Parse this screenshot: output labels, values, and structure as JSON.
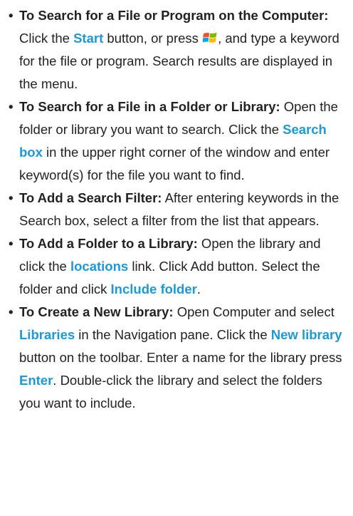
{
  "tips": [
    {
      "parts": [
        {
          "t": "bold",
          "v": "To Search for a File or Program on the Computer:"
        },
        {
          "t": "text",
          "v": " Click the "
        },
        {
          "t": "hl",
          "v": "Start"
        },
        {
          "t": "text",
          "v": " button, or press "
        },
        {
          "t": "icon",
          "v": "windows-logo-icon"
        },
        {
          "t": "text",
          "v": ", and type a keyword for the file or program. Search results are displayed in the menu."
        }
      ]
    },
    {
      "parts": [
        {
          "t": "bold",
          "v": "To Search for a File in a Folder or Library:"
        },
        {
          "t": "text",
          "v": " Open the folder or library you want to search. Click the "
        },
        {
          "t": "hl",
          "v": "Search box"
        },
        {
          "t": "text",
          "v": " in the upper right corner of the window and enter keyword(s) for the file you want to find."
        }
      ]
    },
    {
      "parts": [
        {
          "t": "bold",
          "v": "To Add a Search Filter:"
        },
        {
          "t": "text",
          "v": " After entering keywords in the Search box, select a filter from the list that appears."
        }
      ]
    },
    {
      "parts": [
        {
          "t": "bold",
          "v": "To Add a Folder to a Library:"
        },
        {
          "t": "text",
          "v": " Open the library and click the "
        },
        {
          "t": "hl",
          "v": "locations"
        },
        {
          "t": "text",
          "v": " link. Click Add button. Select the folder and click "
        },
        {
          "t": "hl",
          "v": "Include folder"
        },
        {
          "t": "text",
          "v": "."
        }
      ]
    },
    {
      "parts": [
        {
          "t": "bold",
          "v": "To Create a New Library:"
        },
        {
          "t": "text",
          "v": " Open Computer and select "
        },
        {
          "t": "hl",
          "v": "Libraries"
        },
        {
          "t": "text",
          "v": " in the Navigation pane. Click the "
        },
        {
          "t": "hl",
          "v": "New library"
        },
        {
          "t": "text",
          "v": " button on the toolbar. Enter a name for the library press "
        },
        {
          "t": "hl",
          "v": "Enter"
        },
        {
          "t": "text",
          "v": ". Double-click the library and select the folders you want to include."
        }
      ]
    }
  ],
  "colors": {
    "highlight": "#1a9ad9",
    "text": "#222222",
    "logo_red": "#f25022",
    "logo_green": "#7fba00",
    "logo_blue": "#00a4ef",
    "logo_yellow": "#ffb900"
  }
}
